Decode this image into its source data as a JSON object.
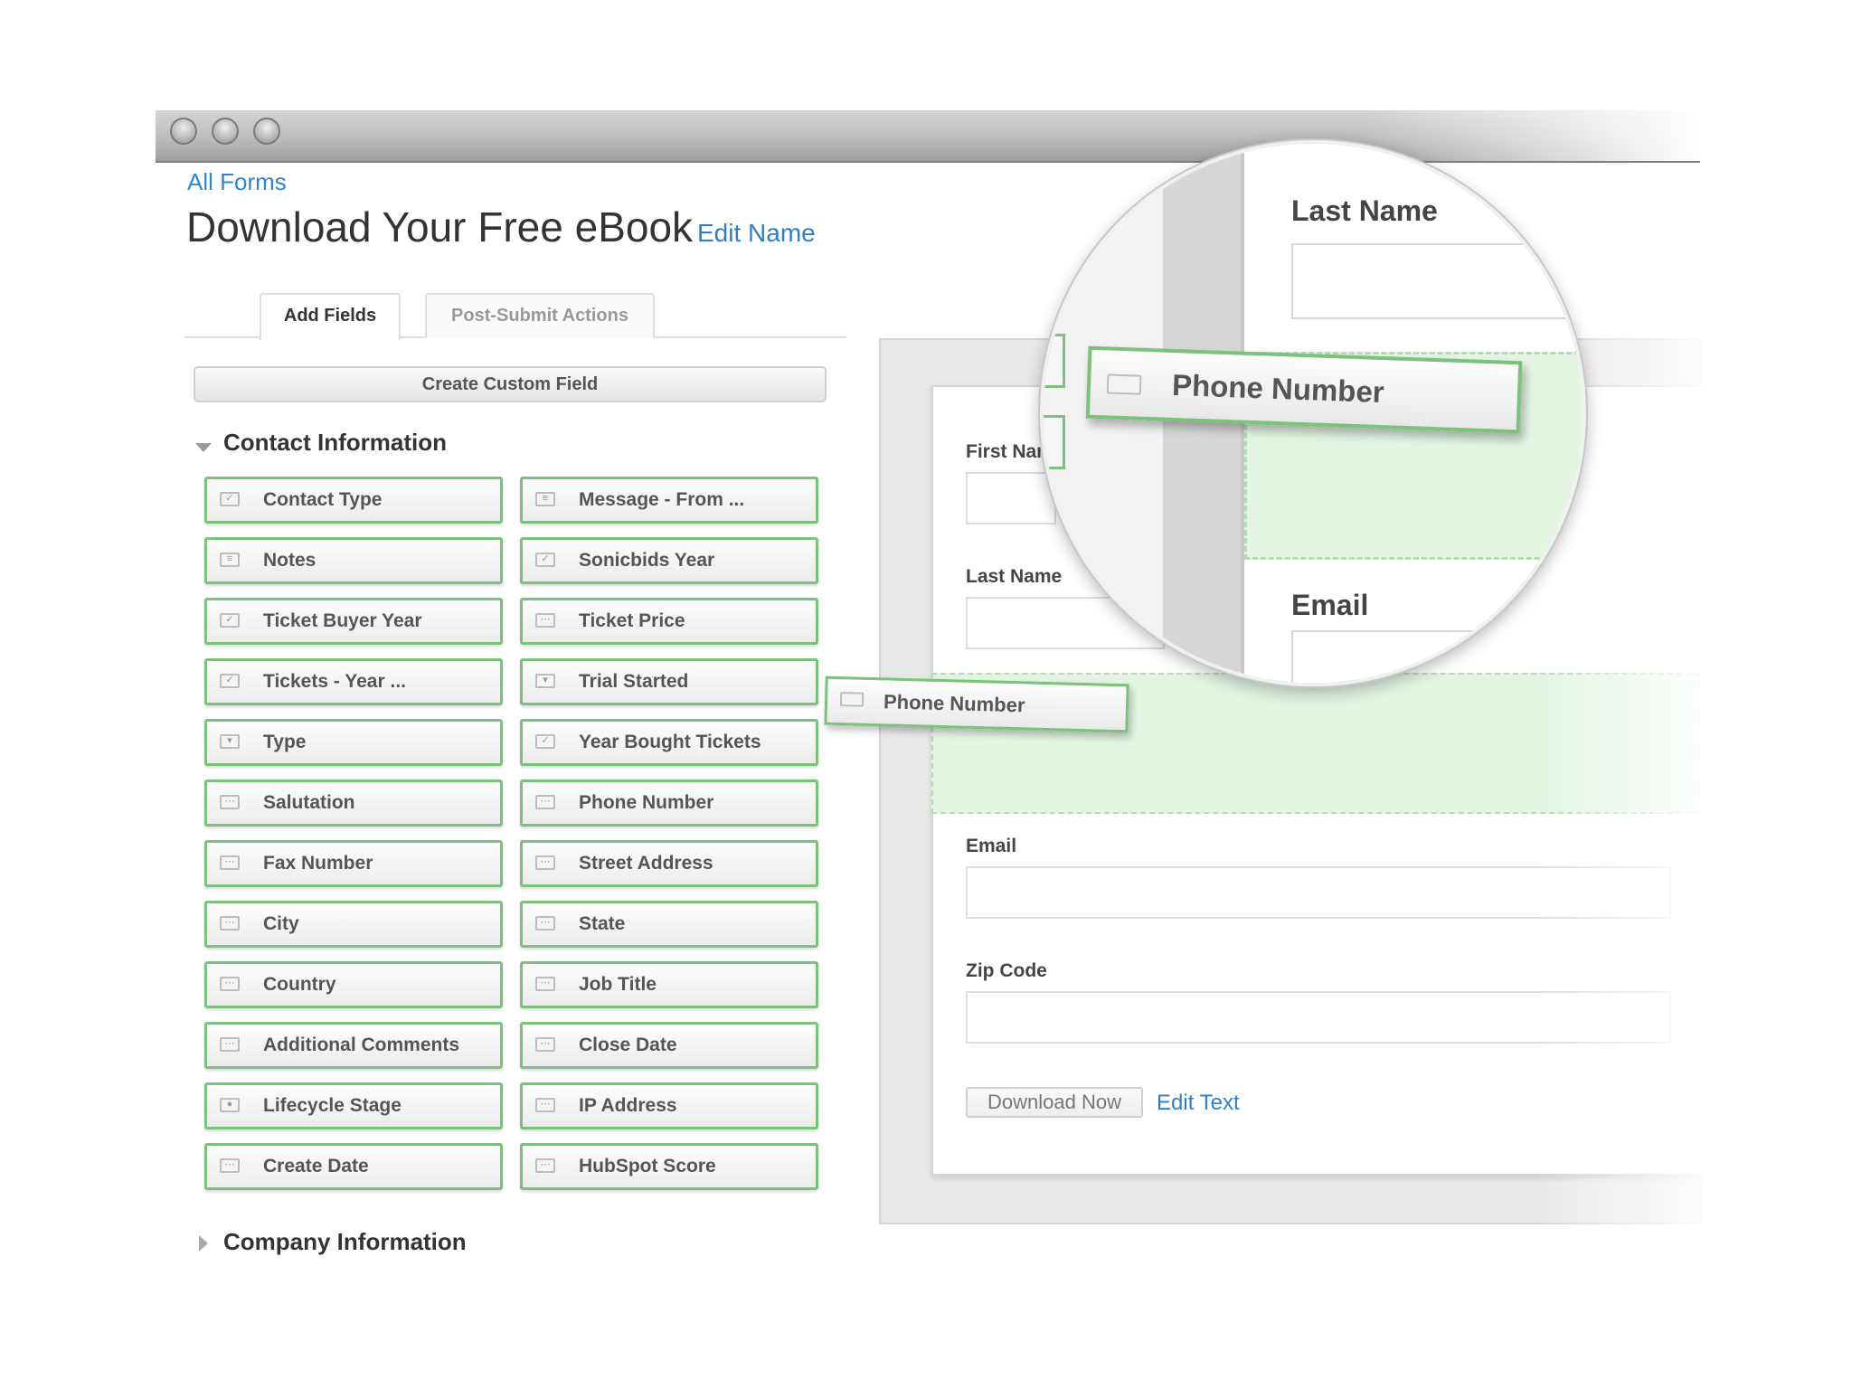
{
  "header": {
    "all_forms": "All Forms",
    "title": "Download Your Free eBook",
    "edit_name": "Edit Name"
  },
  "tabs": [
    {
      "label": "Add Fields",
      "active": true
    },
    {
      "label": "Post-Submit Actions",
      "active": false
    }
  ],
  "create_custom_field": "Create Custom Field",
  "sections": {
    "contact": "Contact Information",
    "company": "Company Information"
  },
  "fields_left": [
    {
      "label": "Contact Type",
      "icon": "checkbox-icon"
    },
    {
      "label": "Notes",
      "icon": "textarea-icon"
    },
    {
      "label": "Ticket Buyer Year",
      "icon": "checkbox-icon"
    },
    {
      "label": "Tickets - Year ...",
      "icon": "checkbox-icon"
    },
    {
      "label": "Type",
      "icon": "select-icon"
    },
    {
      "label": "Salutation",
      "icon": "text-field-icon"
    },
    {
      "label": "Fax Number",
      "icon": "text-field-icon"
    },
    {
      "label": "City",
      "icon": "text-field-icon"
    },
    {
      "label": "Country",
      "icon": "text-field-icon"
    },
    {
      "label": "Additional Comments",
      "icon": "text-field-icon"
    },
    {
      "label": "Lifecycle Stage",
      "icon": "radio-icon"
    },
    {
      "label": "Create Date",
      "icon": "text-field-icon"
    }
  ],
  "fields_right": [
    {
      "label": "Message - From ...",
      "icon": "textarea-icon"
    },
    {
      "label": "Sonicbids Year",
      "icon": "checkbox-icon"
    },
    {
      "label": "Ticket Price",
      "icon": "text-field-icon"
    },
    {
      "label": "Trial Started",
      "icon": "select-icon"
    },
    {
      "label": "Year Bought Tickets",
      "icon": "checkbox-icon"
    },
    {
      "label": "Phone Number",
      "icon": "text-field-icon"
    },
    {
      "label": "Street Address",
      "icon": "text-field-icon"
    },
    {
      "label": "State",
      "icon": "text-field-icon"
    },
    {
      "label": "Job Title",
      "icon": "text-field-icon"
    },
    {
      "label": "Close Date",
      "icon": "text-field-icon"
    },
    {
      "label": "IP Address",
      "icon": "text-field-icon"
    },
    {
      "label": "HubSpot Score",
      "icon": "text-field-icon"
    }
  ],
  "form": {
    "first_name": "First Nan",
    "last_name": "Last Name",
    "email": "Email",
    "zip_code": "Zip Code",
    "submit": "Download Now",
    "edit_text": "Edit Text"
  },
  "dragging_field": "Phone Number",
  "magnifier": {
    "last_name": "Last Name",
    "email": "Email",
    "chip": "Phone Number"
  },
  "colors": {
    "accent_link": "#2e7fc8",
    "field_border": "#7cc27c",
    "drop_zone": "#e3f4e3"
  }
}
